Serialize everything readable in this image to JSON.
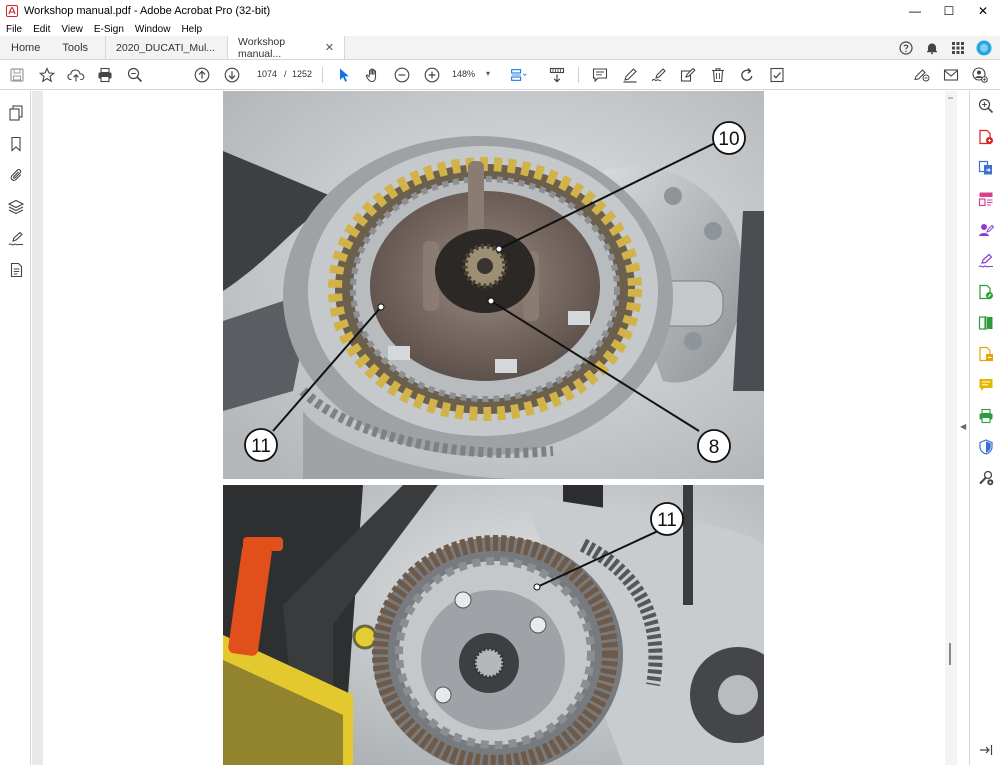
{
  "window": {
    "title": "Workshop manual.pdf - Adobe Acrobat Pro (32-bit)",
    "minimize": "—",
    "maximize": "☐",
    "close": "✕"
  },
  "menu": [
    "File",
    "Edit",
    "View",
    "E-Sign",
    "Window",
    "Help"
  ],
  "tabs": {
    "home": "Home",
    "tools": "Tools",
    "doc_inactive": "2020_DUCATI_Mul...",
    "doc_active": "Workshop manual...",
    "close_glyph": "✕"
  },
  "toolbar": {
    "page_current": "1074",
    "page_separator": "/",
    "page_total": "1252",
    "zoom": "148%"
  },
  "figure1": {
    "callouts": [
      "10",
      "11",
      "8"
    ]
  },
  "figure2": {
    "callouts": [
      "11"
    ]
  },
  "colors": {
    "accent_blue": "#1473e6",
    "brand_red": "#e02020",
    "tool_pink": "#d93f8f",
    "tool_purple": "#8a3fd0",
    "tool_green": "#2d9d3a",
    "tool_yellow": "#e6a500",
    "tool_orange": "#e66c1a",
    "tool_blue": "#3c6fd6"
  },
  "icons": {
    "left_rail": [
      "pages-icon",
      "bookmark-icon",
      "attachment-icon",
      "layers-icon",
      "sign-icon",
      "document-icon"
    ],
    "right_rail": [
      "zoom-search-icon",
      "create-pdf-icon",
      "export-pdf-icon",
      "organize-pages-icon",
      "request-signature-icon",
      "fill-sign-icon",
      "edit-pdf-icon",
      "compare-icon",
      "combine-icon",
      "comment-icon",
      "print-production-icon",
      "protect-icon",
      "more-tools-icon",
      "collapse-panel-icon"
    ]
  }
}
